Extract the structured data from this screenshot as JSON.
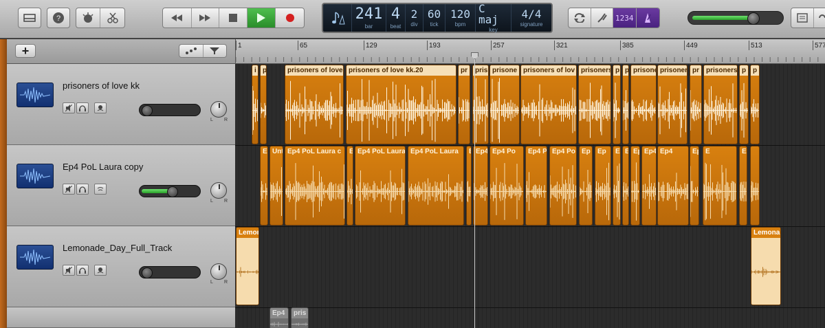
{
  "toolbar": {
    "lcd": {
      "bar": "241",
      "bar_label": "bar",
      "beat": "4",
      "beat_label": "beat",
      "div": "2",
      "div_label": "div",
      "tick": "60",
      "tick_label": "tick",
      "bpm": "120",
      "bpm_label": "bpm",
      "key": "C maj",
      "key_label": "key",
      "signature": "4/4",
      "signature_label": "signature"
    },
    "count_in": "1234",
    "master_volume": 0.72
  },
  "track_header": {
    "add_label": "+"
  },
  "ruler": {
    "ticks": [
      "1",
      "65",
      "129",
      "193",
      "257",
      "321",
      "385",
      "449",
      "513",
      "577"
    ]
  },
  "tracks": [
    {
      "name": "prisoners of love kk",
      "volume": 0.0,
      "pan_left": "L",
      "pan_right": "R"
    },
    {
      "name": "Ep4 PoL Laura copy",
      "volume": 0.55,
      "pan_left": "L",
      "pan_right": "R"
    },
    {
      "name": "Lemonade_Day_Full_Track",
      "volume": 0.0,
      "pan_left": "L",
      "pan_right": "R"
    }
  ],
  "regions": {
    "track1": [
      "i",
      "p",
      "prisoners of love",
      "prisoners of love kk.20",
      "pr",
      "pris",
      "prisone",
      "prisoners of lov",
      "prisoners",
      "p",
      "p",
      "prisone",
      "prisoner",
      "pr",
      "prisoners",
      "p",
      "p"
    ],
    "track2": [
      "E",
      "Unt",
      "Ep4 PoL Laura c",
      "E",
      "Ep4 PoL Laura",
      "Ep4 PoL Laura",
      "E",
      "Ep4",
      "Ep4 Po",
      "Ep4 P",
      "Ep4 Po",
      "Ep",
      "Ep",
      "E",
      "E",
      "Ep4",
      "Ep4 Po",
      "Ep4",
      "Ep4 Po",
      "E",
      "E"
    ],
    "track3": [
      "Lemona",
      "Lemona"
    ],
    "track4": [
      "Ep4",
      "pris"
    ]
  }
}
